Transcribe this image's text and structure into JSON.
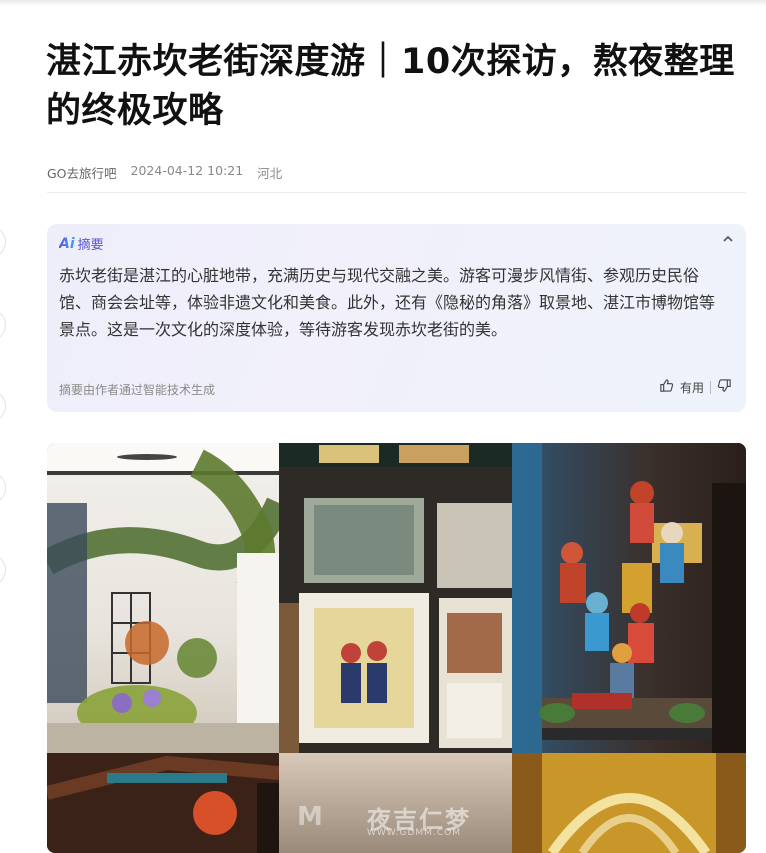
{
  "article": {
    "title": "湛江赤坎老街深度游｜10次探访，熬夜整理的终极攻略",
    "author": "GO去旅行吧",
    "date": "2024-04-12 10:21",
    "region": "河北"
  },
  "ai_summary": {
    "logo": "Ai",
    "label": "摘要",
    "body": "赤坎老街是湛江的心脏地带，充满历史与现代交融之美。游客可漫步风情街、参观历史民俗馆、商会会址等，体验非遗文化和美食。此外，还有《隐秘的角落》取景地、湛江市博物馆等景点。这是一次文化的深度体验，等待游客发现赤坎老街的美。",
    "footer": "摘要由作者通过智能技术生成",
    "useful_label": "有用"
  },
  "watermark": {
    "text": "夜吉仁梦",
    "url": "WWW.GDMM.COM"
  },
  "colors": {
    "ai_accent": "#5b56d9",
    "ai_bg": "#eeeefb"
  }
}
